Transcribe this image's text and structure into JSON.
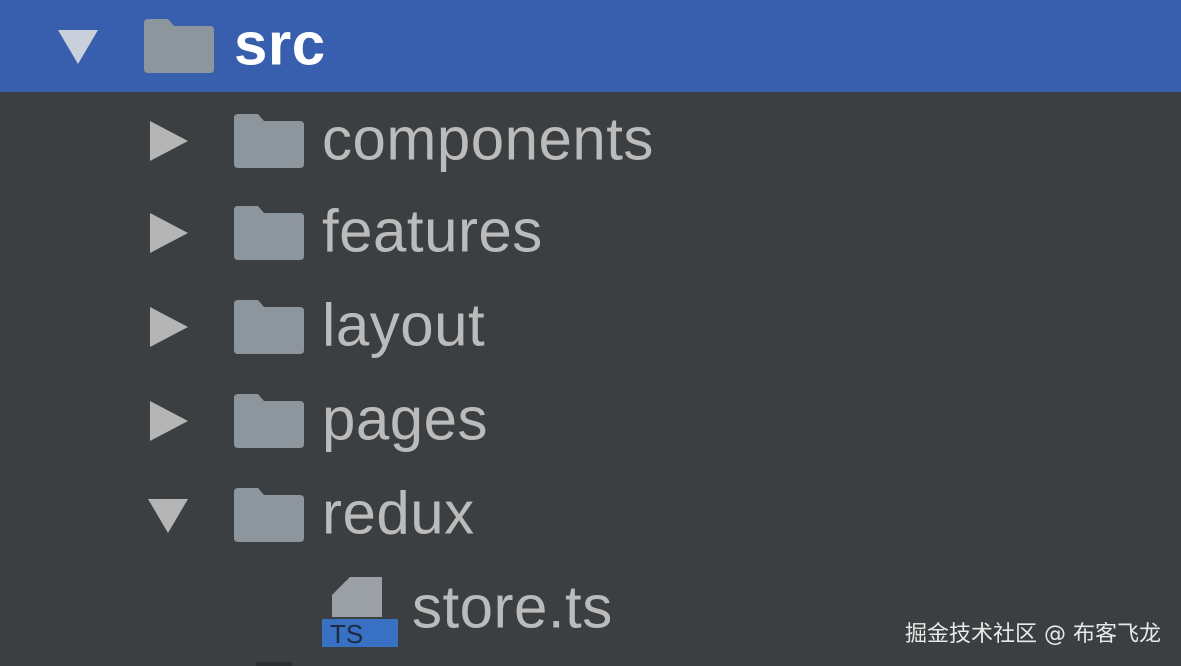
{
  "colors": {
    "background": "#3c3f41",
    "selection": "#375fad",
    "text": "#bbbbbb",
    "selected_text": "#ffffff",
    "folder": "#8d959d",
    "arrow": "#b5b5b5",
    "ts_badge": "#3870c4"
  },
  "tree": {
    "root": {
      "label": "src",
      "expanded": true,
      "icon": "folder-icon"
    },
    "items": [
      {
        "label": "components",
        "expanded": false,
        "icon": "folder-icon"
      },
      {
        "label": "features",
        "expanded": false,
        "icon": "folder-icon"
      },
      {
        "label": "layout",
        "expanded": false,
        "icon": "folder-icon"
      },
      {
        "label": "pages",
        "expanded": false,
        "icon": "folder-icon"
      },
      {
        "label": "redux",
        "expanded": true,
        "icon": "folder-icon"
      }
    ],
    "file": {
      "label": "store.ts",
      "icon": "typescript-file-icon",
      "badge": "TS"
    }
  },
  "watermark": "掘金技术社区 @ 布客飞龙"
}
